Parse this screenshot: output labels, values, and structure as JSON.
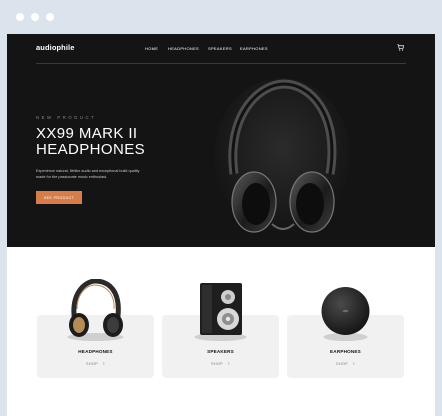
{
  "brand": {
    "logo": "audiophile",
    "accent_color": "#d87d4a"
  },
  "nav": {
    "links": [
      "HOME",
      "HEADPHONES",
      "SPEAKERS",
      "EARPHONES"
    ],
    "cart_icon": "cart-icon"
  },
  "hero": {
    "overline": "NEW PRODUCT",
    "title": "XX99 MARK II HEADPHONES",
    "description": "Experience natural, lifelike audio and exceptional build quality made for the passionate music enthusiast.",
    "cta_label": "SEE PRODUCT"
  },
  "categories": [
    {
      "title": "HEADPHONES",
      "link_label": "SHOP",
      "icon": "chevron-right-icon"
    },
    {
      "title": "SPEAKERS",
      "link_label": "SHOP",
      "icon": "chevron-right-icon"
    },
    {
      "title": "EARPHONES",
      "link_label": "SHOP",
      "icon": "chevron-right-icon"
    }
  ]
}
